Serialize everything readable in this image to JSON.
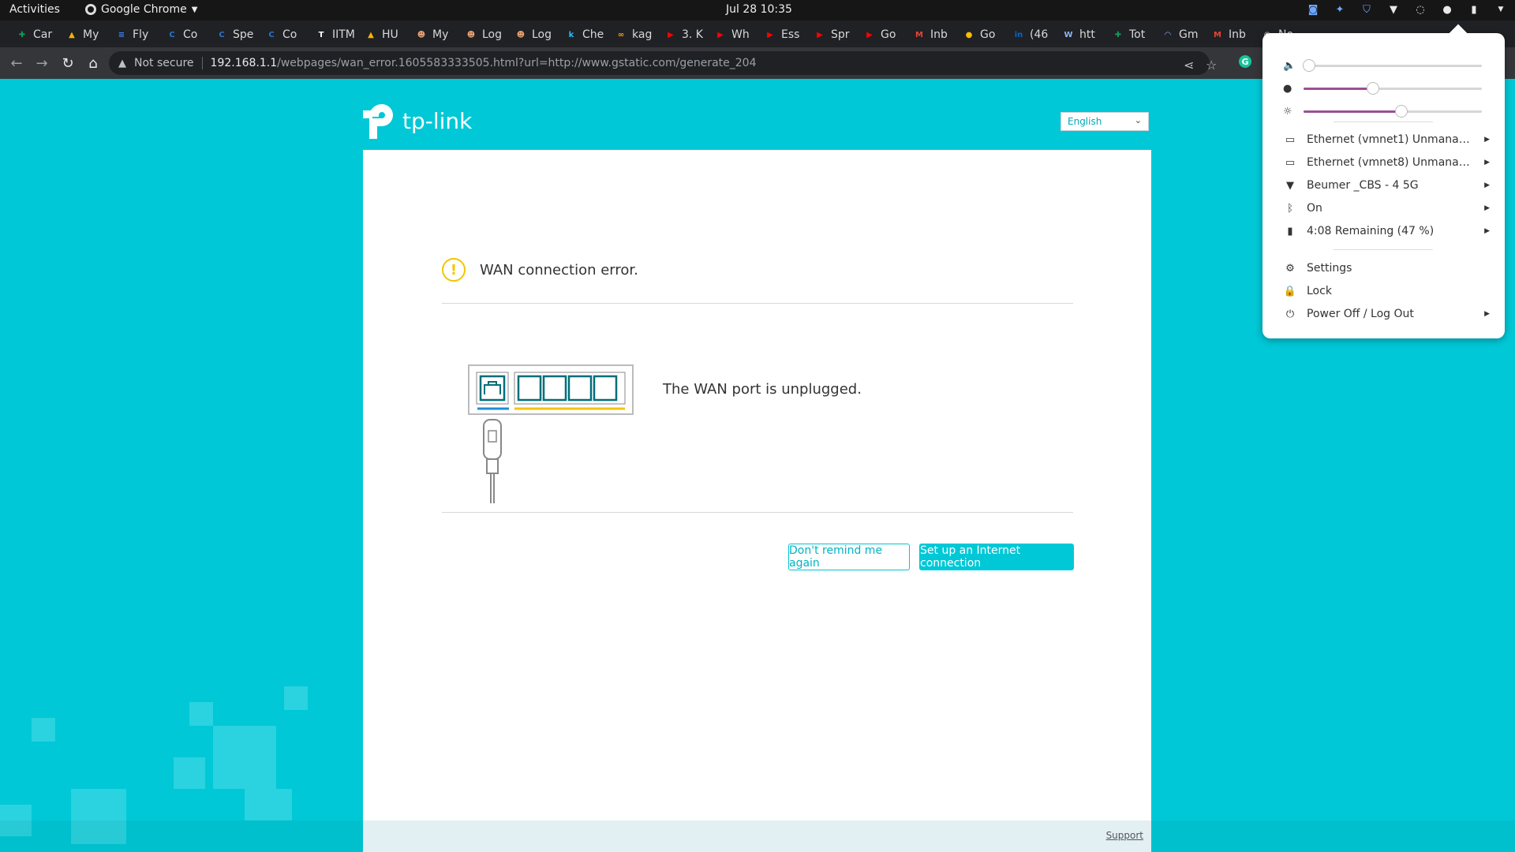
{
  "topbar": {
    "activities": "Activities",
    "app_name": "Google Chrome",
    "datetime": "Jul 28  10:35"
  },
  "tabs": [
    {
      "label": "Car",
      "icon": "sheets-icon",
      "color": "#0f9d58"
    },
    {
      "label": "My",
      "icon": "drive-icon",
      "color": "#f4b400"
    },
    {
      "label": "Fly",
      "icon": "docs-icon",
      "color": "#4285f4"
    },
    {
      "label": "Co",
      "icon": "coursera-icon",
      "color": "#2a73cc"
    },
    {
      "label": "Spe",
      "icon": "coursera-icon",
      "color": "#2a73cc"
    },
    {
      "label": "Co",
      "icon": "coursera-icon",
      "color": "#2a73cc"
    },
    {
      "label": "IITM",
      "icon": "t-icon",
      "color": "#ffffff"
    },
    {
      "label": "HU",
      "icon": "drive-icon",
      "color": "#f4b400"
    },
    {
      "label": "My",
      "icon": "face-icon",
      "color": "#e8a070"
    },
    {
      "label": "Log",
      "icon": "face-icon",
      "color": "#e8a070"
    },
    {
      "label": "Log",
      "icon": "face-icon",
      "color": "#e8a070"
    },
    {
      "label": "Che",
      "icon": "k-icon",
      "color": "#20beff"
    },
    {
      "label": "kag",
      "icon": "infinity-icon",
      "color": "#ff9f1c"
    },
    {
      "label": "3. K",
      "icon": "youtube-icon",
      "color": "#ff0000"
    },
    {
      "label": "Wh",
      "icon": "youtube-icon",
      "color": "#ff0000"
    },
    {
      "label": "Ess",
      "icon": "youtube-icon",
      "color": "#ff0000"
    },
    {
      "label": "Spr",
      "icon": "youtube-icon",
      "color": "#ff0000"
    },
    {
      "label": "Go",
      "icon": "youtube-icon",
      "color": "#ff0000"
    },
    {
      "label": "Inb",
      "icon": "gmail-icon",
      "color": "#ea4335"
    },
    {
      "label": "Go",
      "icon": "keep-icon",
      "color": "#fbbc04"
    },
    {
      "label": "(46",
      "icon": "linkedin-icon",
      "color": "#0a66c2"
    },
    {
      "label": "htt",
      "icon": "w-icon",
      "color": "#8ab4f8"
    },
    {
      "label": "Tot",
      "icon": "sheets-icon",
      "color": "#0f9d58"
    },
    {
      "label": "Gm",
      "icon": "loading-icon",
      "color": "#8ab4f8"
    },
    {
      "label": "Inb",
      "icon": "gmail-icon",
      "color": "#ea4335"
    },
    {
      "label": "No",
      "icon": "chrome-icon",
      "color": "#dddddd"
    }
  ],
  "toolbar": {
    "security": "Not secure",
    "url_host": "192.168.1.1",
    "url_path": "/webpages/wan_error.1605583333505.html?url=http://www.gstatic.com/generate_204"
  },
  "page": {
    "logo_text": "tp-link",
    "language": "English",
    "error_title": "WAN connection error.",
    "unplugged_message": "The WAN port is unplugged.",
    "dont_remind_label": "Don't remind me again",
    "setup_label": "Set up an Internet connection",
    "support_label": "Support",
    "brand_color": "#00c8d7",
    "warning_color": "#f5c400"
  },
  "system_menu": {
    "volume_level": 0.03,
    "mic_level": 0.39,
    "brightness_level": 0.55,
    "slider_color": "#9b4f96",
    "items": [
      {
        "label": "Ethernet (vmnet1) Unmana…",
        "icon": "ethernet-icon",
        "has_submenu": true
      },
      {
        "label": "Ethernet (vmnet8) Unmana…",
        "icon": "ethernet-icon",
        "has_submenu": true
      },
      {
        "label": "Beumer _CBS - 4 5G",
        "icon": "wifi-icon",
        "has_submenu": true
      },
      {
        "label": "On",
        "icon": "bluetooth-icon",
        "has_submenu": true
      },
      {
        "label": "4:08 Remaining (47 %)",
        "icon": "battery-icon",
        "has_submenu": true
      }
    ],
    "actions": [
      {
        "label": "Settings",
        "icon": "gear-icon",
        "has_submenu": false
      },
      {
        "label": "Lock",
        "icon": "lock-icon",
        "has_submenu": false
      },
      {
        "label": "Power Off / Log Out",
        "icon": "power-icon",
        "has_submenu": true
      }
    ]
  }
}
